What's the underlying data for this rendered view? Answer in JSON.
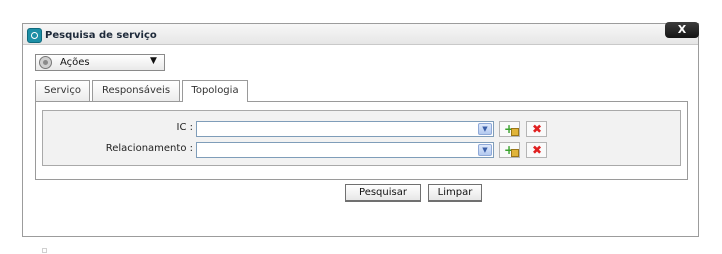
{
  "dialog": {
    "title": "Pesquisa de serviço",
    "close_label": "X"
  },
  "actions_menu": {
    "label": "Ações",
    "arrow": "▼",
    "icon": "gear-icon"
  },
  "tabs": [
    {
      "label": "Serviço",
      "active": false
    },
    {
      "label": "Responsáveis",
      "active": false
    },
    {
      "label": "Topologia",
      "active": true
    }
  ],
  "form": {
    "ic": {
      "label": "IC :",
      "value": ""
    },
    "relacionamento": {
      "label": "Relacionamento :",
      "value": ""
    },
    "icons": {
      "add": "add-icon",
      "remove": "remove-icon",
      "dropdown": "chevron-down-icon"
    }
  },
  "buttons": {
    "search": "Pesquisar",
    "clear": "Limpar"
  }
}
